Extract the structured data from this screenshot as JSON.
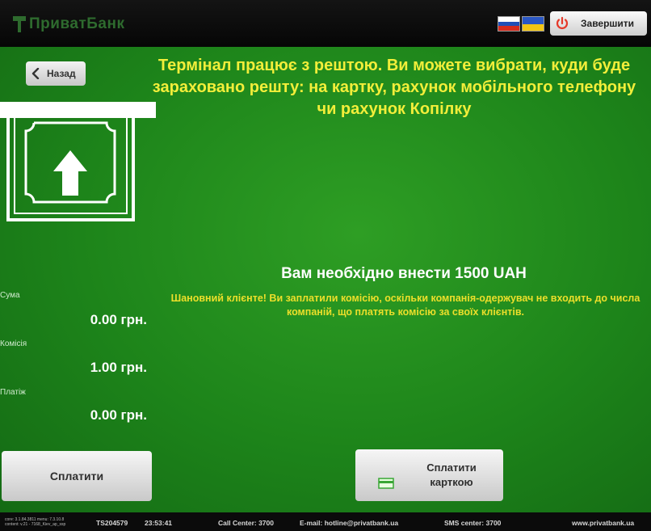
{
  "header": {
    "logo_text": "ПриватБанк",
    "exit_label": "Завершити"
  },
  "back_label": "Назад",
  "headline": "Термінал працює з рештою. Ви можете вибрати, куди буде зараховано решту: на картку, рахунок мобільного телефону чи рахунок Копілку",
  "amount_due": "Вам необхідно внести  1500 UAH",
  "commission_note": "Шановний клієнте! Ви заплатили комісію, оскільки компанія-одержувач не входить до числа компаній, що платять комісію за своїх клієнтів.",
  "summary": {
    "sum_label": "Сума",
    "sum_value": "0.00 грн.",
    "fee_label": "Комісія",
    "fee_value": "1.00 грн.",
    "payment_label": "Платіж",
    "payment_value": "0.00 грн."
  },
  "buttons": {
    "pay": "Сплатити",
    "pay_card_line1": "Сплатити",
    "pay_card_line2": "карткою"
  },
  "footer": {
    "core_version": "core: 3.1.84.3811  menu: 7.3.10.8",
    "content_version": "content: v.21 - 7168_Kiev_ap_ssp",
    "terminal_id": "TS204579",
    "time": "23:53:41",
    "call_center": "Call Center: 3700",
    "email": "E-mail: hotline@privatbank.ua",
    "sms_center": "SMS center: 3700",
    "website": "www.privatbank.ua"
  },
  "colors": {
    "background_green": "#1d841a",
    "headline_yellow": "#f2ee3a",
    "note_yellow": "#ecdf2a",
    "exit_icon_red": "#e53a2a"
  },
  "icons": {
    "logo": "privatbank-logo-icon",
    "flag_ru": "russian-flag-icon",
    "flag_ua": "ukrainian-flag-icon",
    "exit": "power-icon",
    "back": "chevron-left-icon",
    "cash": "cash-insert-icon",
    "card": "card-icon"
  }
}
